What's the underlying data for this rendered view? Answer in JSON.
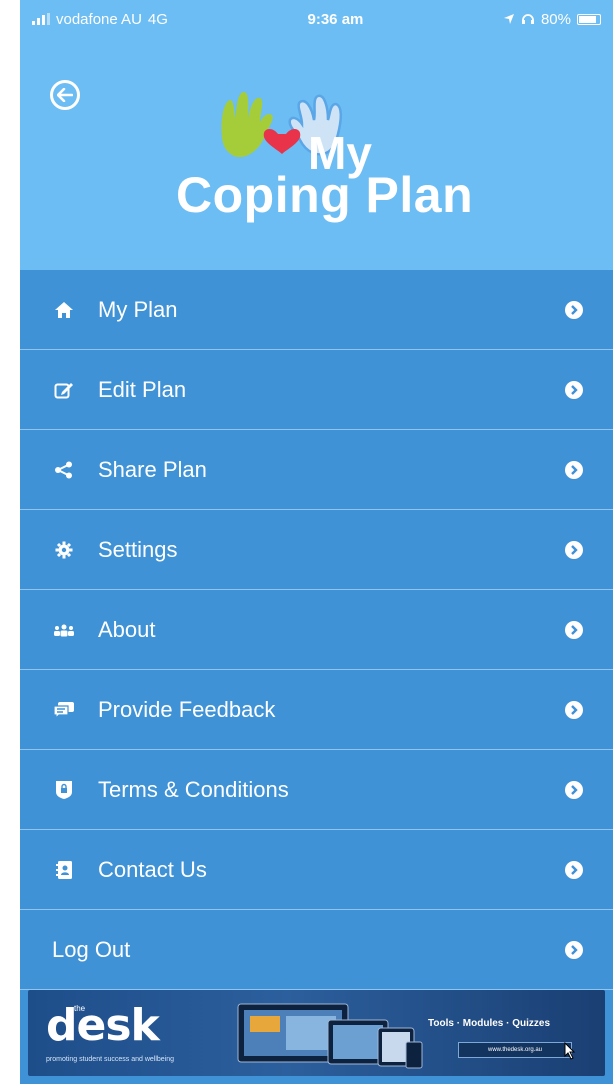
{
  "status_bar": {
    "carrier": "vodafone AU",
    "network": "4G",
    "time": "9:36 am",
    "battery": "80%"
  },
  "header": {
    "logo_line1": "My",
    "logo_line2": "Coping Plan"
  },
  "menu": [
    {
      "label": "My Plan",
      "icon": "home-icon"
    },
    {
      "label": "Edit Plan",
      "icon": "edit-icon"
    },
    {
      "label": "Share Plan",
      "icon": "share-icon"
    },
    {
      "label": "Settings",
      "icon": "gear-icon"
    },
    {
      "label": "About",
      "icon": "users-icon"
    },
    {
      "label": "Provide Feedback",
      "icon": "feedback-icon"
    },
    {
      "label": "Terms & Conditions",
      "icon": "shield-icon"
    },
    {
      "label": "Contact Us",
      "icon": "address-book-icon"
    },
    {
      "label": "Log Out",
      "icon": ""
    }
  ],
  "banner": {
    "brand_sup": "the",
    "brand": "desk",
    "tagline": "promoting student success and wellbeing",
    "links": "Tools · Modules · Quizzes",
    "url": "www.thedesk.org.au"
  },
  "colors": {
    "header_bg": "#6cbdf4",
    "menu_bg": "#3f92d6",
    "divider": "#8fc5ee"
  }
}
